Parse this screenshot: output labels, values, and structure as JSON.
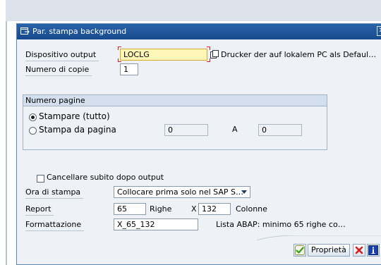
{
  "dialog": {
    "title": "Par. stampa background",
    "close_glyph": "✕"
  },
  "output_device": {
    "label": "Dispositivo output",
    "value": "LOCLG",
    "description": "Drucker der auf lokalem PC als Defaul…"
  },
  "copies": {
    "label": "Numero di copie",
    "value": "1"
  },
  "pages": {
    "header": "Numero pagine",
    "print_all_label": "Stampare (tutto)",
    "print_from_label": "Stampa da pagina",
    "from_value": "0",
    "to_label": "A",
    "to_value": "0"
  },
  "delete_after": {
    "label": "Cancellare subito dopo output"
  },
  "print_time": {
    "label": "Ora di stampa",
    "value": "Collocare prima solo nel SAP S…"
  },
  "report": {
    "label": "Report",
    "rows_value": "65",
    "rows_label": "Righe",
    "x_label": "X",
    "cols_value": "132",
    "cols_label": "Colonne"
  },
  "format": {
    "label": "Formattazione",
    "value": "X_65_132",
    "description": "Lista ABAP: minimo 65 righe co…"
  },
  "buttons": {
    "properties_label": "Proprietà"
  },
  "icons": {
    "title": "dialog-window-icon",
    "device_help": "copy-icon",
    "confirm": "checkmark-icon",
    "cancel": "cancel-x-icon",
    "info": "info-icon"
  },
  "colors": {
    "titlebar": "#1f5597",
    "focused_field": "#fff7b8",
    "confirm_green": "#3a9a1c",
    "cancel_red": "#d42020",
    "info_blue": "#1a3faa"
  }
}
